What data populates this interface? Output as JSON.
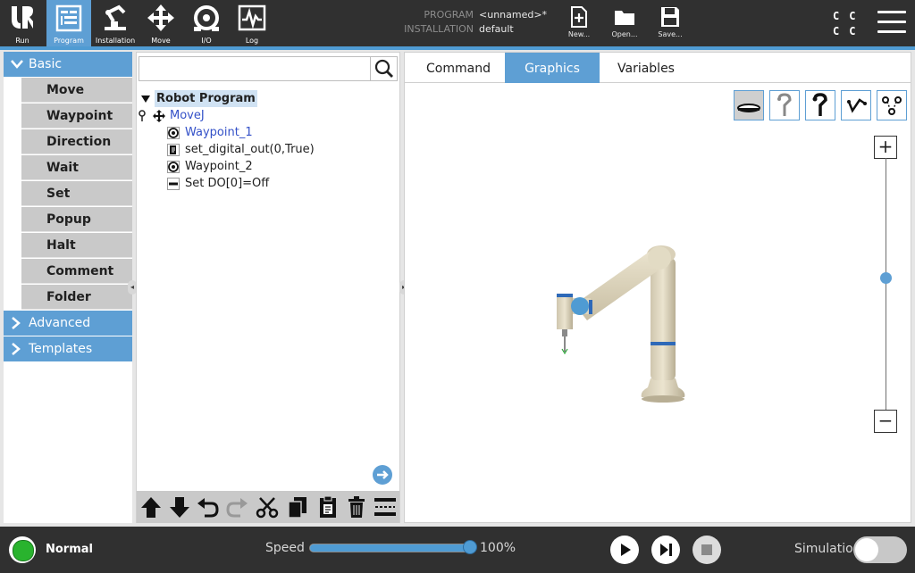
{
  "nav": [
    {
      "label": "Run",
      "icon": "ur-logo-icon"
    },
    {
      "label": "Program",
      "icon": "program-icon",
      "active": true
    },
    {
      "label": "Installation",
      "icon": "installation-icon"
    },
    {
      "label": "Move",
      "icon": "move-icon"
    },
    {
      "label": "I/O",
      "icon": "io-icon"
    },
    {
      "label": "Log",
      "icon": "log-icon"
    }
  ],
  "program_info": {
    "program_label": "PROGRAM",
    "program_value": "<unnamed>*",
    "installation_label": "INSTALLATION",
    "installation_value": "default"
  },
  "file_actions": {
    "new_label": "New...",
    "open_label": "Open...",
    "save_label": "Save..."
  },
  "cc_indicator": [
    "C",
    "C",
    "C",
    "C"
  ],
  "sidebar": {
    "basic": {
      "label": "Basic",
      "items": [
        "Move",
        "Waypoint",
        "Direction",
        "Wait",
        "Set",
        "Popup",
        "Halt",
        "Comment",
        "Folder"
      ]
    },
    "advanced_label": "Advanced",
    "templates_label": "Templates"
  },
  "tree": {
    "search_value": "",
    "root": "Robot Program",
    "rows": [
      {
        "text": "MoveJ",
        "icon": "move-icon"
      },
      {
        "text": "Waypoint_1",
        "icon": "waypoint-icon"
      },
      {
        "text": "set_digital_out(0,True)",
        "icon": "script-icon"
      },
      {
        "text": "Waypoint_2",
        "icon": "waypoint-icon"
      },
      {
        "text": "Set DO[0]=Off",
        "icon": "set-icon"
      }
    ]
  },
  "tabs": [
    "Command",
    "Graphics",
    "Variables"
  ],
  "active_tab": "Graphics",
  "zoom": {
    "plus": "+",
    "minus": "−",
    "level": 0.48
  },
  "bottom": {
    "status": "Normal",
    "status_color": "#29b32e",
    "speed_label": "Speed",
    "speed_value": "100%",
    "speed_fraction": 1.0,
    "simulation_label": "Simulation",
    "simulation_on": false
  },
  "colors": {
    "accent": "#5e9fd4",
    "topbar": "#303030",
    "selection": "#d0e2f3"
  }
}
